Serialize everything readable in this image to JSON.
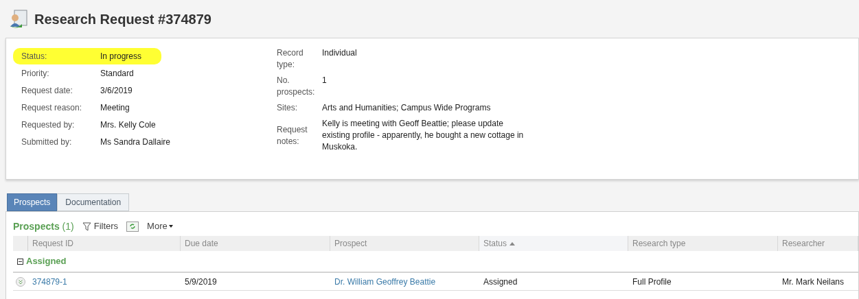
{
  "title": "Research Request #374879",
  "details_left": [
    {
      "label": "Status:",
      "value": "In progress",
      "highlighted": true
    },
    {
      "label": "Priority:",
      "value": "Standard",
      "highlighted": false
    },
    {
      "label": "Request date:",
      "value": "3/6/2019",
      "highlighted": false
    },
    {
      "label": "Request reason:",
      "value": "Meeting",
      "highlighted": false
    },
    {
      "label": "Requested by:",
      "value": "Mrs. Kelly Cole",
      "highlighted": false
    },
    {
      "label": "Submitted by:",
      "value": "Ms Sandra Dallaire",
      "highlighted": false
    }
  ],
  "details_right": [
    {
      "label": "Record type:",
      "value": "Individual"
    },
    {
      "label": "No. prospects:",
      "value": "1"
    },
    {
      "label": "Sites:",
      "value": "Arts and Humanities; Campus Wide Programs"
    },
    {
      "label": "Request notes:",
      "value": "Kelly is meeting with Geoff Beattie; please update existing profile - apparently, he bought a new cottage in Muskoka."
    }
  ],
  "tabs": [
    {
      "label": "Prospects",
      "selected": true
    },
    {
      "label": "Documentation",
      "selected": false
    }
  ],
  "grid": {
    "title": "Prospects",
    "count": "(1)",
    "filters": "Filters",
    "more": "More",
    "columns": [
      {
        "label": "Request ID",
        "sorted": false
      },
      {
        "label": "Due date",
        "sorted": false
      },
      {
        "label": "Prospect",
        "sorted": false
      },
      {
        "label": "Status",
        "sorted": true
      },
      {
        "label": "Research type",
        "sorted": false
      },
      {
        "label": "Researcher",
        "sorted": false
      }
    ],
    "groups": [
      {
        "label": "Assigned",
        "expanded": true,
        "rows": [
          {
            "cells": [
              "374879-1",
              "5/9/2019",
              "Dr. William Geoffrey Beattie",
              "Assigned",
              "Full Profile",
              "Mr. Mark Neilans"
            ],
            "link_cells": [
              true,
              false,
              true,
              false,
              false,
              false
            ]
          }
        ]
      }
    ]
  }
}
